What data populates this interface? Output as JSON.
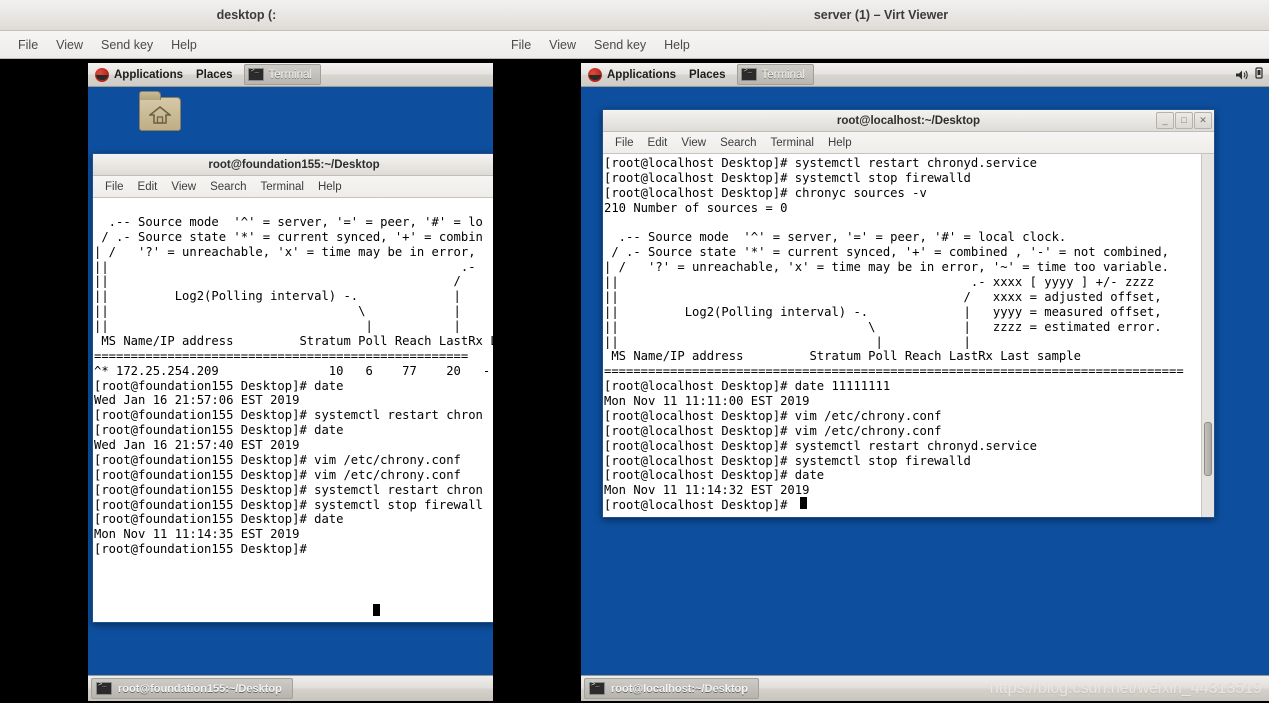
{
  "left_window": {
    "title": "desktop (:",
    "menu": [
      "File",
      "View",
      "Send key",
      "Help"
    ],
    "panel": {
      "applications": "Applications",
      "places": "Places",
      "task": "Terminal",
      "hat_icon": "redhat-icon",
      "terminal_icon": "terminal-icon"
    },
    "desktop": {
      "home_folder_label": ""
    },
    "terminal": {
      "title": "root@foundation155:~/Desktop",
      "menu": [
        "File",
        "Edit",
        "View",
        "Search",
        "Terminal",
        "Help"
      ],
      "content": "\n  .-- Source mode  '^' = server, '=' = peer, '#' = lo\n / .- Source state '*' = current synced, '+' = combin\n| /   '?' = unreachable, 'x' = time may be in error,\n||                                                .-\n||                                               /  \n||         Log2(Polling interval) -.             |  \n||                                  \\            |  \n||                                   |           |  \n MS Name/IP address         Stratum Poll Reach LastRx L\n===================================================\n^* 172.25.254.209               10   6    77    20   -\n[root@foundation155 Desktop]# date\nWed Jan 16 21:57:06 EST 2019\n[root@foundation155 Desktop]# systemctl restart chron\n[root@foundation155 Desktop]# date\nWed Jan 16 21:57:40 EST 2019\n[root@foundation155 Desktop]# vim /etc/chrony.conf\n[root@foundation155 Desktop]# vim /etc/chrony.conf\n[root@foundation155 Desktop]# systemctl restart chron\n[root@foundation155 Desktop]# systemctl stop firewall\n[root@foundation155 Desktop]# date\nMon Nov 11 11:14:35 EST 2019\n[root@foundation155 Desktop]# "
    },
    "taskbar": {
      "task": "root@foundation155:~/Desktop",
      "icon": "terminal-icon"
    }
  },
  "right_window": {
    "title": "server (1) – Virt Viewer",
    "menu": [
      "File",
      "View",
      "Send key",
      "Help"
    ],
    "panel": {
      "applications": "Applications",
      "places": "Places",
      "task": "Terminal",
      "hat_icon": "redhat-icon",
      "terminal_icon": "terminal-icon",
      "tray": [
        "volume-icon",
        "network-icon"
      ]
    },
    "terminal": {
      "title": "root@localhost:~/Desktop",
      "menu": [
        "File",
        "Edit",
        "View",
        "Search",
        "Terminal",
        "Help"
      ],
      "buttons": {
        "minimize": "_",
        "maximize": "□",
        "close": "✕"
      },
      "content": "[root@localhost Desktop]# systemctl restart chronyd.service\n[root@localhost Desktop]# systemctl stop firewalld\n[root@localhost Desktop]# chronyc sources -v\n210 Number of sources = 0\n\n  .-- Source mode  '^' = server, '=' = peer, '#' = local clock.\n / .- Source state '*' = current synced, '+' = combined , '-' = not combined,\n| /   '?' = unreachable, 'x' = time may be in error, '~' = time too variable.\n||                                                .- xxxx [ yyyy ] +/- zzzz\n||                                               /   xxxx = adjusted offset,\n||         Log2(Polling interval) -.             |   yyyy = measured offset,\n||                                  \\            |   zzzz = estimated error.\n||                                   |           |\n MS Name/IP address         Stratum Poll Reach LastRx Last sample\n===============================================================================\n[root@localhost Desktop]# date 11111111\nMon Nov 11 11:11:00 EST 2019\n[root@localhost Desktop]# vim /etc/chrony.conf\n[root@localhost Desktop]# vim /etc/chrony.conf\n[root@localhost Desktop]# systemctl restart chronyd.service\n[root@localhost Desktop]# systemctl stop firewalld\n[root@localhost Desktop]# date\nMon Nov 11 11:14:32 EST 2019\n[root@localhost Desktop]# "
    },
    "taskbar": {
      "task": "root@localhost:~/Desktop",
      "icon": "terminal-icon"
    },
    "watermark": "https://blog.csdn.net/weixin_44313519"
  },
  "colors": {
    "desktop_blue": "#0d4f9e",
    "panel_grey": "#e2dfdb",
    "terminal_bg": "#ffffff",
    "terminal_fg": "#000000",
    "window_border": "#1d4f91"
  }
}
